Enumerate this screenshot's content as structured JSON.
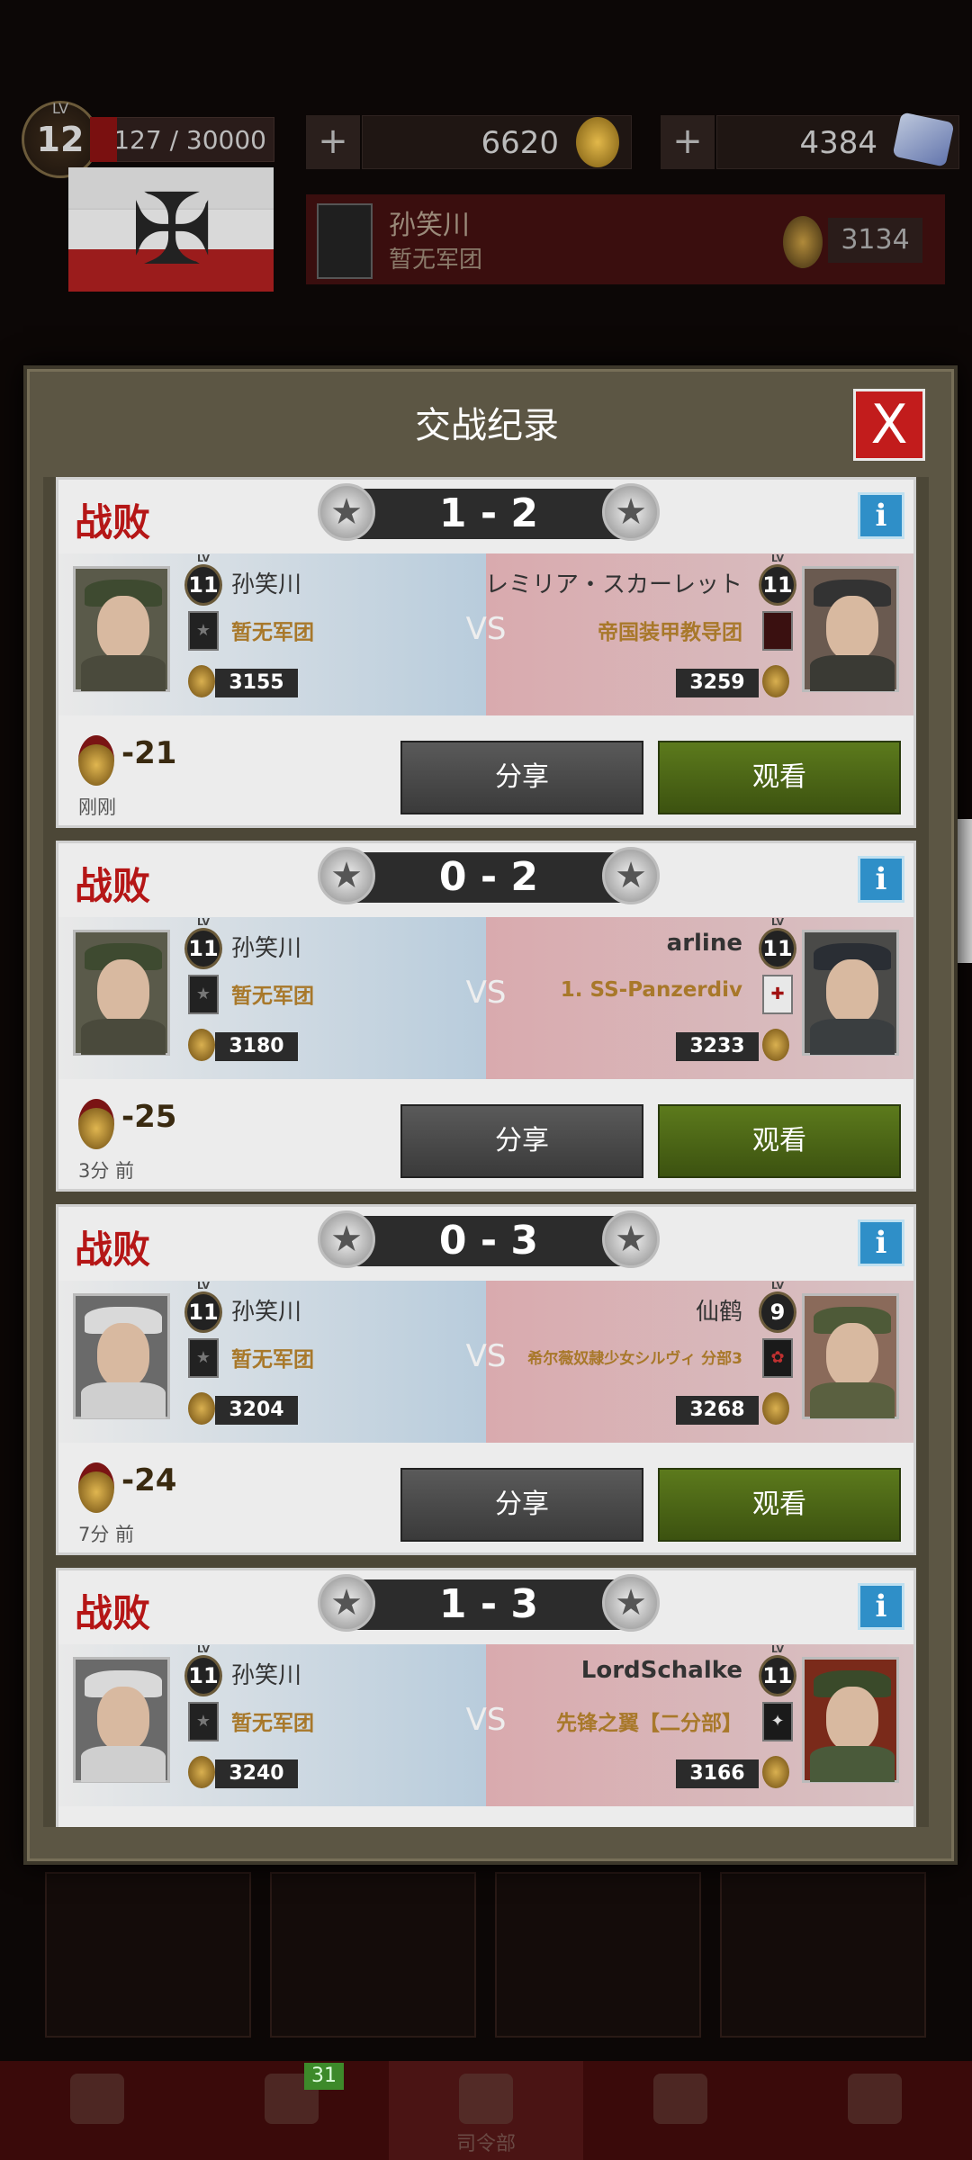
{
  "header": {
    "level_label": "LV",
    "level": "12",
    "xp": "6127 / 30000",
    "gold_plus": "+",
    "gold": "6620",
    "gems_plus": "+",
    "gems": "4384",
    "player_name": "孙笑川",
    "player_legion": "暂无军团",
    "rank_points": "3134"
  },
  "dialog": {
    "title": "交战纪录",
    "close_label": "X"
  },
  "battles": [
    {
      "result": "战败",
      "score": "1 - 2",
      "vs": "VS",
      "left": {
        "name": "孙笑川",
        "level": "11",
        "legion": "暂无军团",
        "rank": "3155"
      },
      "right": {
        "name": "レミリア・スカーレット",
        "level": "11",
        "legion": "帝国装甲教导团",
        "rank": "3259"
      },
      "delta": "-21",
      "time": "刚刚",
      "share_label": "分享",
      "watch_label": "观看",
      "info_label": "i"
    },
    {
      "result": "战败",
      "score": "0 - 2",
      "vs": "VS",
      "left": {
        "name": "孙笑川",
        "level": "11",
        "legion": "暂无军团",
        "rank": "3180"
      },
      "right": {
        "name": "arline",
        "level": "11",
        "legion": "1. SS-Panzerdiv",
        "rank": "3233"
      },
      "delta": "-25",
      "time": "3分 前",
      "share_label": "分享",
      "watch_label": "观看",
      "info_label": "i"
    },
    {
      "result": "战败",
      "score": "0 - 3",
      "vs": "VS",
      "left": {
        "name": "孙笑川",
        "level": "11",
        "legion": "暂无军团",
        "rank": "3204"
      },
      "right": {
        "name": "仙鹤",
        "level": "9",
        "legion": "希尔薇奴隷少女シルヴィ 分部3",
        "rank": "3268"
      },
      "delta": "-24",
      "time": "7分 前",
      "share_label": "分享",
      "watch_label": "观看",
      "info_label": "i"
    },
    {
      "result": "战败",
      "score": "1 - 3",
      "vs": "VS",
      "left": {
        "name": "孙笑川",
        "level": "11",
        "legion": "暂无军团",
        "rank": "3240"
      },
      "right": {
        "name": "LordSchalke",
        "level": "11",
        "legion": "先锋之翼【二分部】",
        "rank": "3166"
      },
      "delta": "",
      "time": "",
      "share_label": "分享",
      "watch_label": "观看",
      "info_label": "i"
    }
  ],
  "nav": {
    "items": [
      "",
      "",
      "司令部",
      "",
      ""
    ],
    "badge": "31"
  },
  "colors": {
    "defeat": "#b51616",
    "watch_button": "#4c6a16",
    "info_button": "#2f8fc8",
    "close_button": "#c21c1c"
  }
}
